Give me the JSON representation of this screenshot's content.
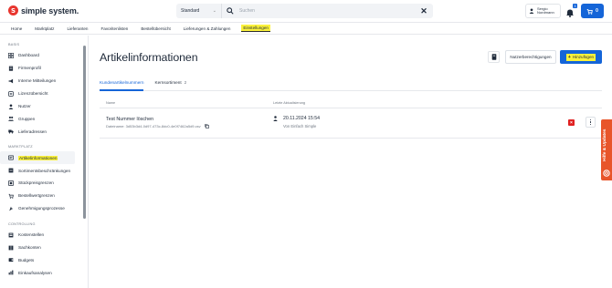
{
  "brand": {
    "name": "simple system.",
    "accent": "#1565d8",
    "highlight": "#fbf23b",
    "logo_color": "#e8352e"
  },
  "search": {
    "scope": "Standard",
    "placeholder": "Suchen"
  },
  "user": {
    "first": "Sergio",
    "last": "Nordmann"
  },
  "notifications": {
    "count": "3"
  },
  "cart": {
    "count": "0"
  },
  "nav": [
    {
      "label": "Home"
    },
    {
      "label": "Marktplatz"
    },
    {
      "label": "Lieferanten"
    },
    {
      "label": "Favoritenlisten"
    },
    {
      "label": "Bestellübersicht"
    },
    {
      "label": "Lieferungen & Zahlungen"
    },
    {
      "label": "Einstellungen",
      "active": true
    }
  ],
  "sidebar": {
    "sections": [
      {
        "title": "BASIS",
        "items": [
          {
            "label": "Dashboard",
            "icon": "grid-icon"
          },
          {
            "label": "Firmenprofil",
            "icon": "building-icon"
          },
          {
            "label": "Interne Mitteilungen",
            "icon": "megaphone-icon"
          },
          {
            "label": "Lizenzübersicht",
            "icon": "license-icon"
          },
          {
            "label": "Nutzer",
            "icon": "user-icon"
          },
          {
            "label": "Gruppen",
            "icon": "group-icon"
          },
          {
            "label": "Lieferadressen",
            "icon": "truck-icon"
          }
        ]
      },
      {
        "title": "MARKTPLATZ",
        "items": [
          {
            "label": "Artikelinformationen",
            "icon": "article-icon",
            "active": true
          },
          {
            "label": "Sortimentsbeschränkungen",
            "icon": "restriction-icon"
          },
          {
            "label": "Stückpreisgrenzen",
            "icon": "price-icon"
          },
          {
            "label": "Bestellwertgrenzen",
            "icon": "order-limit-icon"
          },
          {
            "label": "Genehmigungsprozesse",
            "icon": "approval-icon"
          }
        ]
      },
      {
        "title": "CONTROLLING",
        "items": [
          {
            "label": "Kostenstellen",
            "icon": "cost-center-icon"
          },
          {
            "label": "Sachkonten",
            "icon": "ledger-icon"
          },
          {
            "label": "Budgets",
            "icon": "budget-icon"
          },
          {
            "label": "Einkaufsanalysen",
            "icon": "analytics-icon"
          }
        ]
      }
    ]
  },
  "main": {
    "title": "Artikelinformationen",
    "permissions_label": "Nutzerberechtigungen",
    "add_label": "Hinzufügen",
    "tabs": [
      {
        "label": "Kundenartikelnummern",
        "count": "",
        "active": true
      },
      {
        "label": "Kernsortiment",
        "count": "2",
        "active": false
      }
    ],
    "table": {
      "headers": {
        "name": "Name",
        "updated": "Letzte Aktualisierung"
      },
      "rows": [
        {
          "name": "Test Nummer löschen",
          "sub": "Dateiname: 3d53b3d4-0d97-473c-8dc0-4e0f7462a5d9.csv",
          "date": "20.11.2024 15:54",
          "by": "Von Einfach Simple"
        }
      ]
    }
  },
  "help_tab": {
    "label": "Hilfe & Updates"
  }
}
